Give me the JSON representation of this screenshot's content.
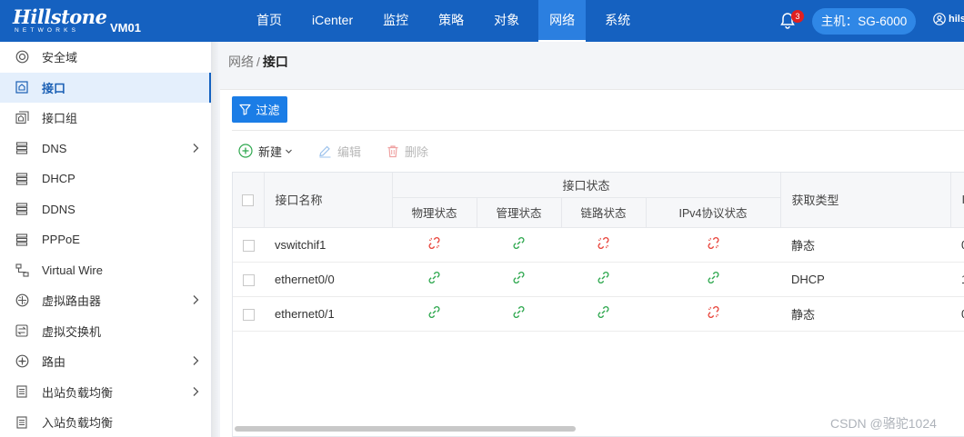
{
  "header": {
    "logo_text": "Hillstone",
    "logo_subtext": "NETWORKS",
    "device": "VM01",
    "nav": [
      "首页",
      "iCenter",
      "监控",
      "策略",
      "对象",
      "网络",
      "系统"
    ],
    "active_nav_index": 5,
    "notification_count": "3",
    "host_label": "主机：SG-6000",
    "user": "hils"
  },
  "sidebar": {
    "items": [
      {
        "label": "安全域",
        "icon": "zone-icon",
        "has_submenu": false
      },
      {
        "label": "接口",
        "icon": "interface-icon",
        "has_submenu": false,
        "active": true
      },
      {
        "label": "接口组",
        "icon": "interface-group-icon",
        "has_submenu": false
      },
      {
        "label": "DNS",
        "icon": "server-icon",
        "has_submenu": true
      },
      {
        "label": "DHCP",
        "icon": "server-icon",
        "has_submenu": false
      },
      {
        "label": "DDNS",
        "icon": "server-icon",
        "has_submenu": false
      },
      {
        "label": "PPPoE",
        "icon": "server-icon",
        "has_submenu": false
      },
      {
        "label": "Virtual Wire",
        "icon": "virtual-wire-icon",
        "has_submenu": false
      },
      {
        "label": "虚拟路由器",
        "icon": "router-icon",
        "has_submenu": true
      },
      {
        "label": "虚拟交换机",
        "icon": "switch-icon",
        "has_submenu": false
      },
      {
        "label": "路由",
        "icon": "route-icon",
        "has_submenu": true
      },
      {
        "label": "出站负载均衡",
        "icon": "load-balance-icon",
        "has_submenu": true
      },
      {
        "label": "入站负载均衡",
        "icon": "load-balance-icon",
        "has_submenu": false
      }
    ]
  },
  "breadcrumb": {
    "parent": "网络",
    "separator": "/",
    "current": "接口"
  },
  "filter_label": "过滤",
  "toolbar": {
    "new_label": "新建",
    "edit_label": "编辑",
    "delete_label": "删除"
  },
  "table": {
    "group_header": "接口状态",
    "name_header": "接口名称",
    "sub_headers": [
      "物理状态",
      "管理状态",
      "链路状态",
      "IPv4协议状态"
    ],
    "type_header": "获取类型",
    "next_header_partial": "I",
    "rows": [
      {
        "name": "vswitchif1",
        "status": [
          "down",
          "up",
          "down",
          "down"
        ],
        "type": "静态",
        "next_partial": "0"
      },
      {
        "name": "ethernet0/0",
        "status": [
          "up",
          "up",
          "up",
          "up"
        ],
        "type": "DHCP",
        "next_partial": "1"
      },
      {
        "name": "ethernet0/1",
        "status": [
          "up",
          "up",
          "up",
          "down"
        ],
        "type": "静态",
        "next_partial": "0"
      }
    ]
  },
  "colors": {
    "up": "#2fa84f",
    "down": "#e8453c",
    "primary": "#1561c0"
  },
  "watermark": "CSDN @骆驼1024"
}
